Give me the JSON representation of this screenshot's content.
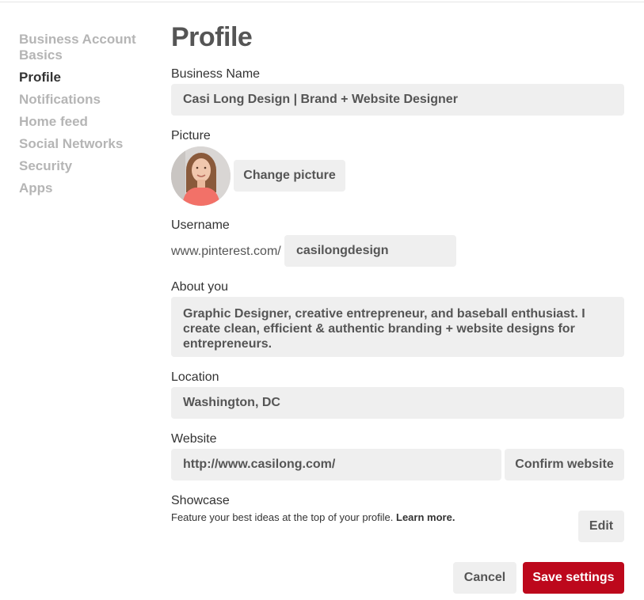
{
  "sidebar": {
    "items": [
      {
        "label": "Business Account Basics"
      },
      {
        "label": "Profile"
      },
      {
        "label": "Notifications"
      },
      {
        "label": "Home feed"
      },
      {
        "label": "Social Networks"
      },
      {
        "label": "Security"
      },
      {
        "label": "Apps"
      }
    ],
    "active_index": 1
  },
  "main": {
    "title": "Profile",
    "business_name": {
      "label": "Business Name",
      "value": "Casi Long Design | Brand + Website Designer"
    },
    "picture": {
      "label": "Picture",
      "change_button": "Change picture"
    },
    "username": {
      "label": "Username",
      "prefix": "www.pinterest.com/",
      "value": "casilongdesign"
    },
    "about": {
      "label": "About you",
      "value": "Graphic Designer, creative entrepreneur, and baseball enthusiast. I create clean, efficient & authentic branding + website designs for entrepreneurs."
    },
    "location": {
      "label": "Location",
      "value": "Washington, DC"
    },
    "website": {
      "label": "Website",
      "value": "http://www.casilong.com/",
      "confirm_button": "Confirm website"
    },
    "showcase": {
      "label": "Showcase",
      "description": "Feature your best ideas at the top of your profile.",
      "learn_more": "Learn more.",
      "edit_button": "Edit"
    },
    "actions": {
      "cancel": "Cancel",
      "save": "Save settings"
    }
  },
  "colors": {
    "accent_red": "#bd081c",
    "field_bg": "#efefef",
    "sidebar_inactive": "#b5b5b5"
  }
}
